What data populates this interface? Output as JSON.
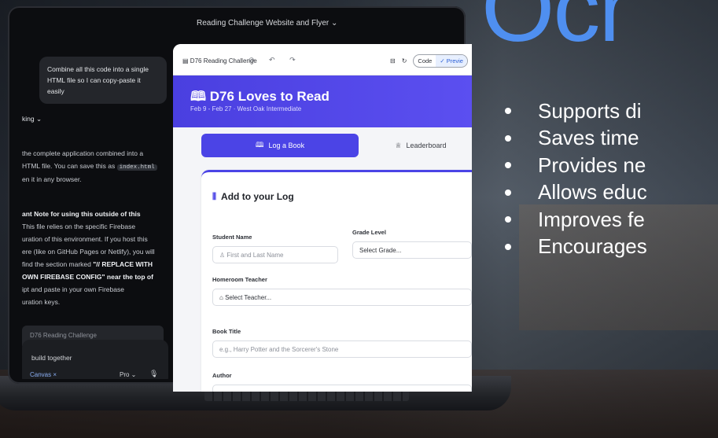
{
  "slide": {
    "headline_fragment": "Ocr",
    "bullets": [
      "Supports di",
      "Saves time",
      "Provides ne",
      "Allows educ",
      "Improves fe",
      "Encourages"
    ],
    "colors": {
      "headline": "#4f8ff0",
      "bullet_text": "#ffffff"
    }
  },
  "window": {
    "title": "Reading Challenge Website and Flyer ⌄"
  },
  "chat": {
    "user_message": "Combine all this code into a single HTML file so I can copy-paste it easily",
    "thinking_label": "king ⌄",
    "response_line1": "the complete application combined into a",
    "response_line2": "HTML file. You can save this as",
    "filename": "index.html",
    "response_line3": "en it in any browser.",
    "note_title": "ant Note for using this outside of this",
    "note_lines": [
      "This file relies on the specific Firebase",
      "uration of this environment. If you host this",
      "ere (like on GitHub Pages or Netlify), you will",
      "find the section marked",
      "OWN FIREBASE CONFIG\" near the top of",
      "ipt and paste in your own Firebase",
      "uration keys."
    ],
    "note_marker": "\"// REPLACE WITH",
    "canvas_card_title": "D76 Reading Challenge",
    "input_text": "build together",
    "canvas_tag": "Canvas ×",
    "model": "Pro ⌄",
    "mic_icon": "microphone-icon"
  },
  "canvas": {
    "toolbar_title": "D76 Reading Challenge",
    "toolbar_icons": "⊘ ↶ ↷",
    "code_label": "Code",
    "preview_label": "✓ Previe",
    "app": {
      "title": "D76 Loves to Read",
      "subtitle": "Feb 9 - Feb 27 · West Oak Intermediate",
      "tab_log": "Log a Book",
      "tab_leaderboard": "Leaderboard",
      "form_title": "Add to your Log",
      "student_name_label": "Student Name",
      "student_name_placeholder": "First and Last Name",
      "grade_label": "Grade Level",
      "grade_value": "Select Grade...",
      "teacher_label": "Homeroom Teacher",
      "teacher_value": "Select Teacher...",
      "book_title_label": "Book Title",
      "book_title_placeholder": "e.g., Harry Potter and the Sorcerer's Stone",
      "author_label": "Author"
    },
    "colors": {
      "brand": "#4b44e6"
    }
  }
}
